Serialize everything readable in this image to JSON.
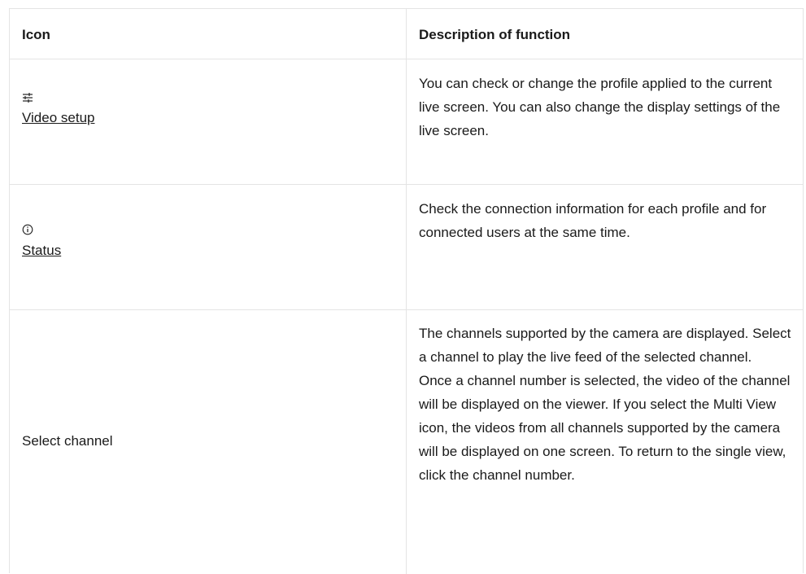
{
  "table": {
    "header": {
      "col1": "Icon",
      "col2": "Description of function"
    },
    "rows": [
      {
        "icon": "sliders-icon",
        "label": "Video setup",
        "description": "You can check or change the profile applied to the current live screen. You can also change the display settings of the live screen."
      },
      {
        "icon": "info-circle-icon",
        "label": "Status",
        "description": "Check the connection information for each profile and for connected users at the same time."
      },
      {
        "label": "Select channel",
        "description_lines": [
          "The channels supported by the camera are displayed. Select a channel to play the live feed of the selected channel.",
          "Once a channel number is selected, the video of the channel will be displayed on the viewer. If you select the Multi View icon, the videos from all channels supported by the camera will be displayed on one screen. To return to the single view, click the channel number."
        ]
      }
    ]
  }
}
